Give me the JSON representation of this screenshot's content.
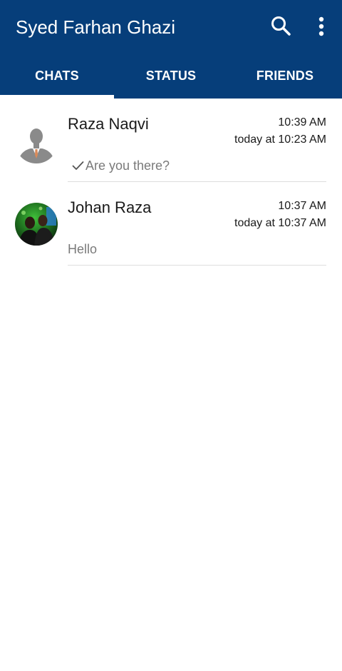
{
  "app": {
    "title": "Syed Farhan Ghazi",
    "accent_color": "#063e7a",
    "icons": {
      "search": "search-icon",
      "menu": "more-vert-icon"
    }
  },
  "tabs": [
    {
      "label": "CHATS",
      "selected": true
    },
    {
      "label": "STATUS",
      "selected": false
    },
    {
      "label": "FRIENDS",
      "selected": false
    }
  ],
  "chats": [
    {
      "name": "Raza Naqvi",
      "time": "10:39 AM",
      "seen": "today at 10:23 AM",
      "preview": "Are you there?",
      "sent_check": true,
      "avatar": "default-person-avatar"
    },
    {
      "name": "Johan Raza",
      "time": "10:37 AM",
      "seen": "today at 10:37 AM",
      "preview": "Hello",
      "sent_check": false,
      "avatar": "photo-avatar"
    }
  ]
}
